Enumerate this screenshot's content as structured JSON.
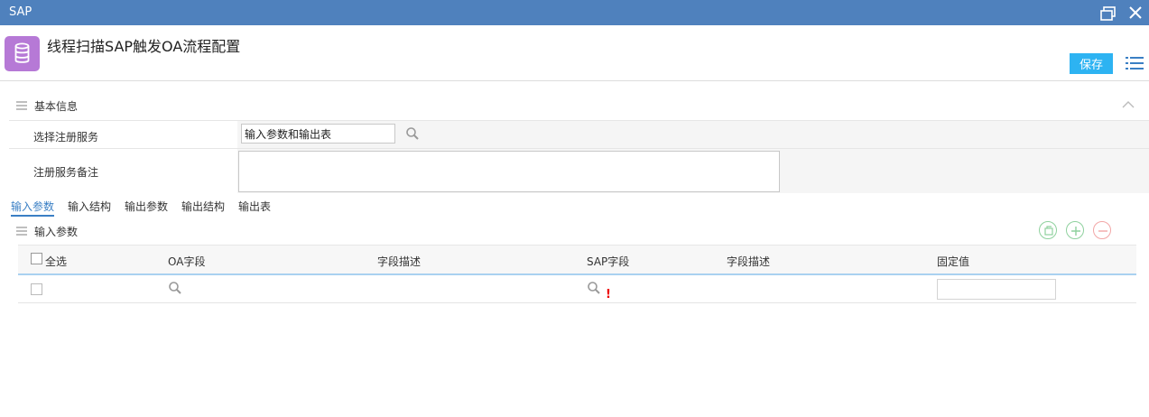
{
  "window": {
    "title": "SAP"
  },
  "header": {
    "title": "线程扫描SAP触发OA流程配置",
    "save_label": "保存"
  },
  "basic_info": {
    "title": "基本信息",
    "service_label": "选择注册服务",
    "service_value": "输入参数和输出表",
    "remark_label": "注册服务备注",
    "remark_value": ""
  },
  "tabs": [
    "输入参数",
    "输入结构",
    "输出参数",
    "输出结构",
    "输出表"
  ],
  "params_section": {
    "title": "输入参数"
  },
  "table": {
    "select_all_label": "全选",
    "columns": [
      "OA字段",
      "字段描述",
      "SAP字段",
      "字段描述",
      "固定值"
    ],
    "rows": [
      {
        "oa_field": "",
        "oa_desc": "",
        "sap_field": "",
        "sap_desc": "",
        "fixed_value": ""
      }
    ]
  },
  "colors": {
    "titlebar": "#4f81bd",
    "accent": "#2db3f2",
    "module_icon": "#b679d6",
    "tab_active": "#3a7fc4"
  },
  "icons": {
    "module": "database-icon",
    "menu": "list-icon",
    "search": "search-icon",
    "add": "plus-circle-icon",
    "remove": "minus-circle-icon",
    "copy": "copy-icon"
  }
}
